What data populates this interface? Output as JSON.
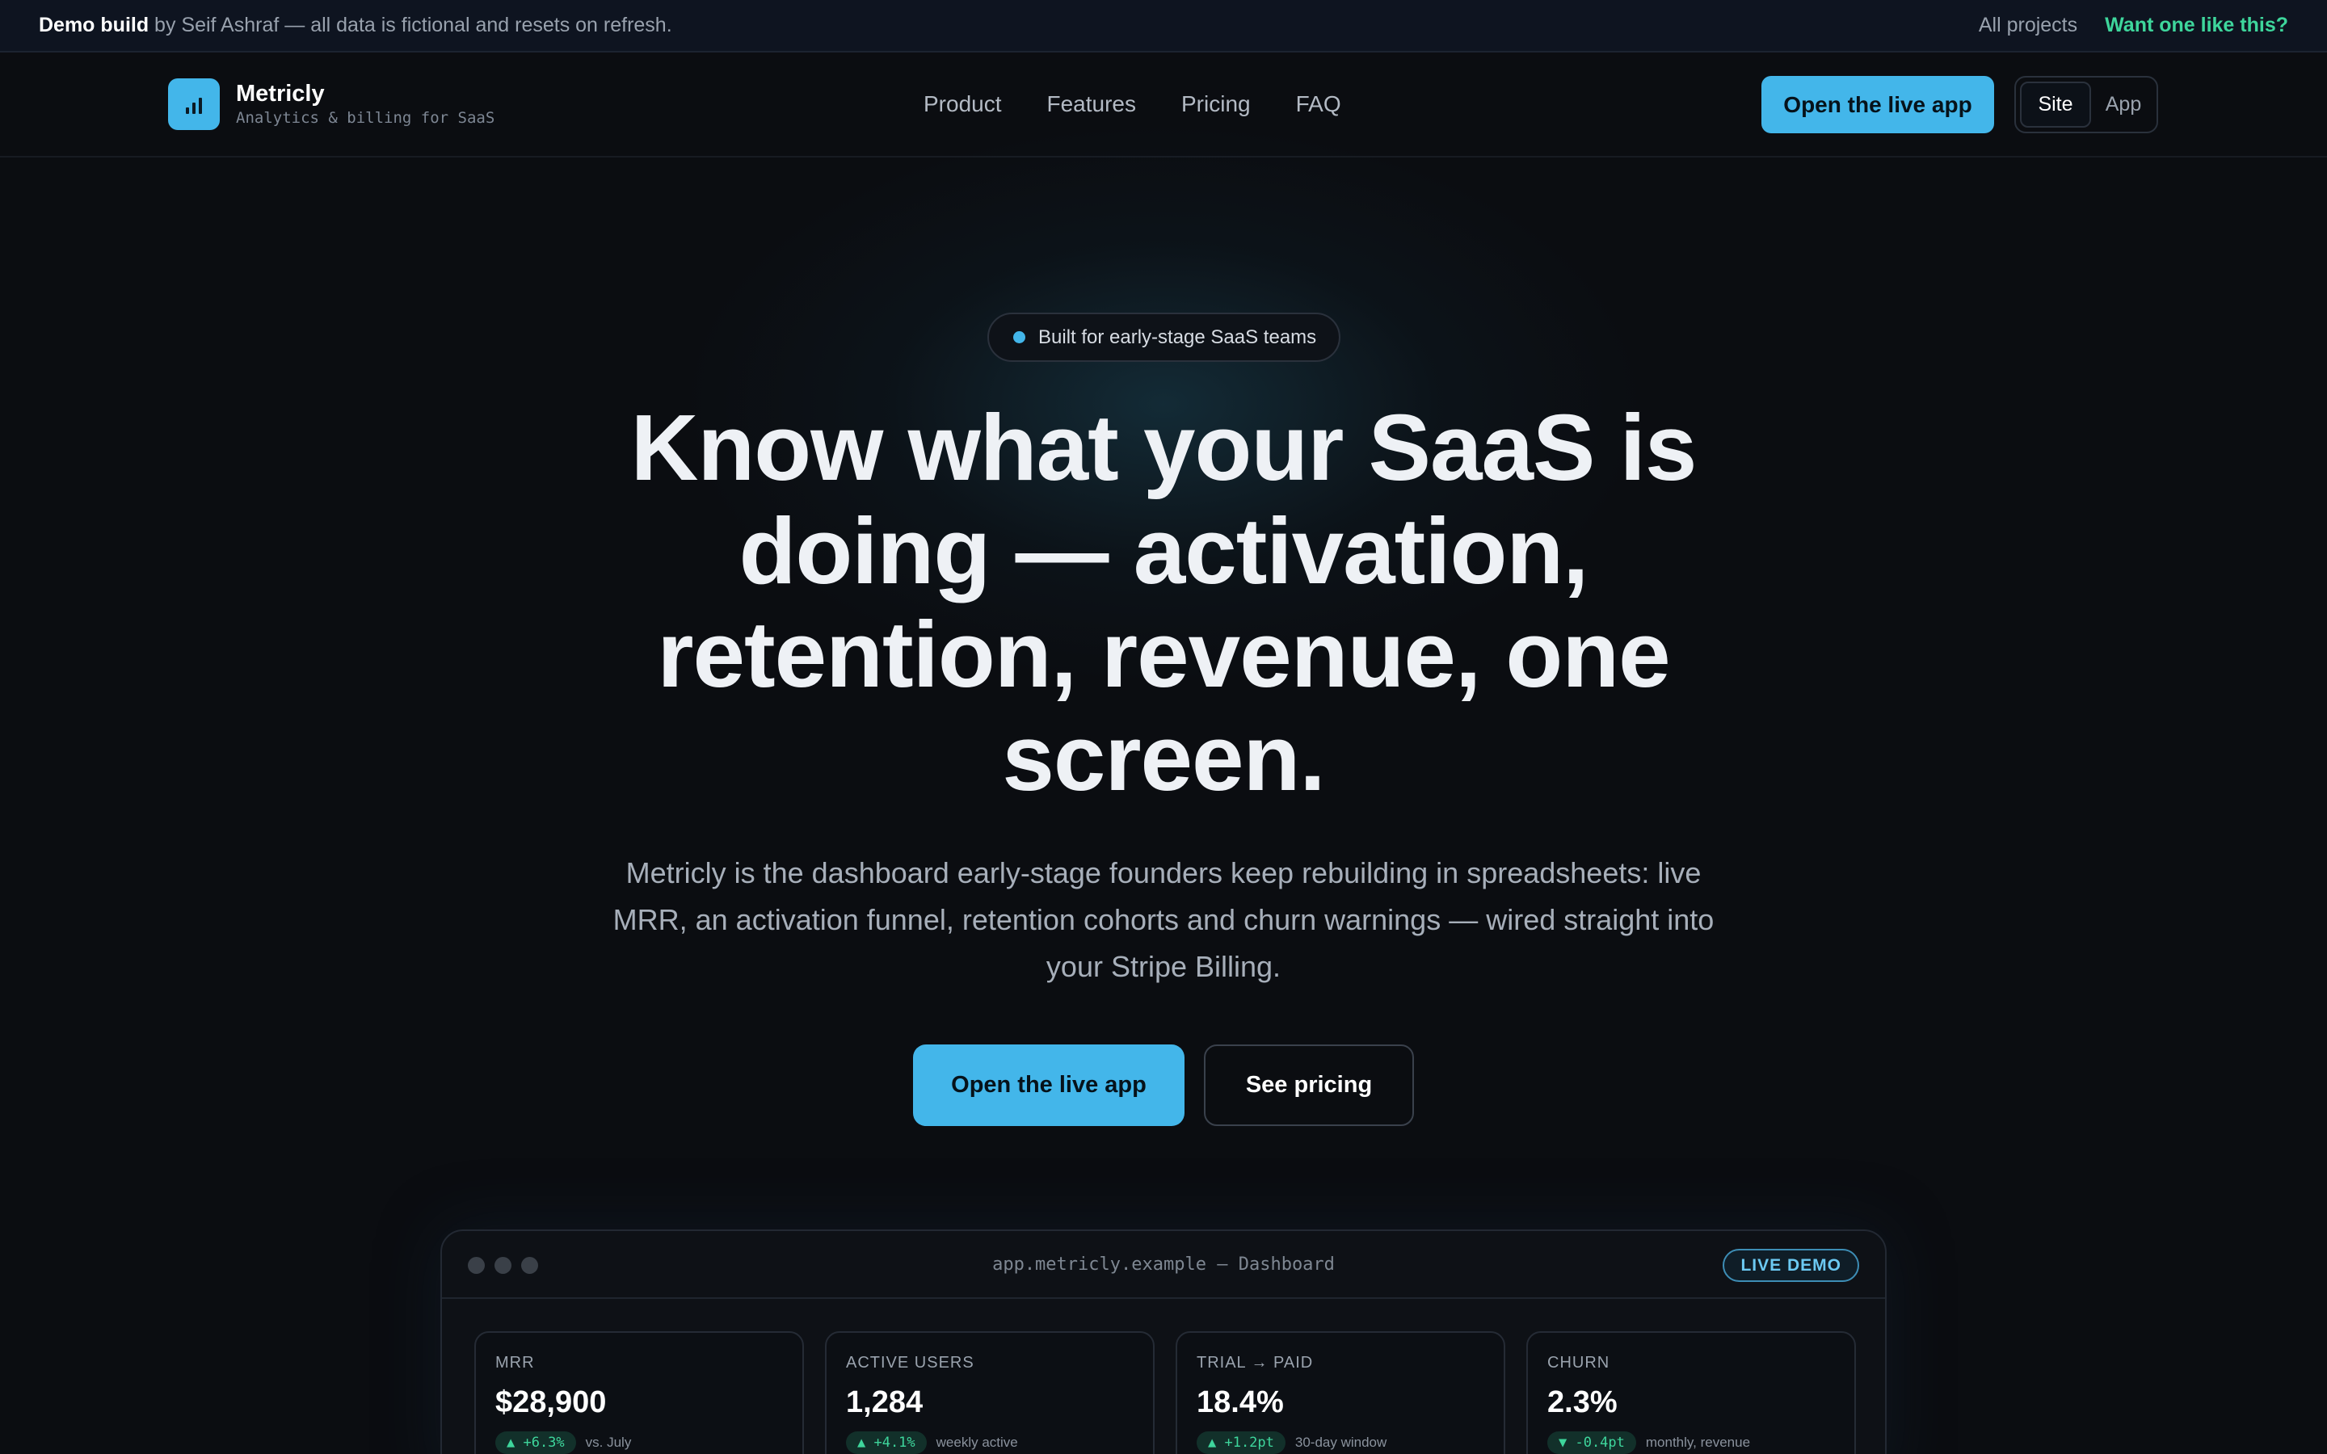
{
  "banner": {
    "strong": "Demo build",
    "text": " by Seif Ashraf — all data is fictional and resets on refresh.",
    "all_projects": "All projects",
    "cta": "Want one like this?"
  },
  "nav": {
    "brand_name": "Metricly",
    "brand_tagline": "Analytics & billing for SaaS",
    "links": [
      "Product",
      "Features",
      "Pricing",
      "FAQ"
    ],
    "cta": "Open the live app",
    "toggle": {
      "site": "Site",
      "app": "App",
      "selected": "Site"
    }
  },
  "hero": {
    "pill": "Built for early-stage SaaS teams",
    "headline": "Know what your SaaS is doing — activation, retention, revenue, one screen.",
    "subtitle": "Metricly is the dashboard early-stage founders keep rebuilding in spreadsheets: live MRR, an activation funnel, retention cohorts and churn warnings — wired straight into your Stripe Billing.",
    "primary_button": "Open the live app",
    "secondary_button": "See pricing"
  },
  "preview": {
    "url": "app.metricly.example — Dashboard",
    "badge": "LIVE DEMO",
    "cards": [
      {
        "label": "MRR",
        "value": "$28,900",
        "delta": "▲ +6.3%",
        "note": "vs. July"
      },
      {
        "label": "ACTIVE USERS",
        "value": "1,284",
        "delta": "▲ +4.1%",
        "note": "weekly active"
      },
      {
        "label": "TRIAL → PAID",
        "value": "18.4%",
        "delta": "▲ +1.2pt",
        "note": "30-day window"
      },
      {
        "label": "CHURN",
        "value": "2.3%",
        "delta": "▼ -0.4pt",
        "note": "monthly, revenue"
      }
    ]
  },
  "colors": {
    "accent": "#43b6ea",
    "positive": "#3ed69c",
    "background": "#0b0d11"
  }
}
